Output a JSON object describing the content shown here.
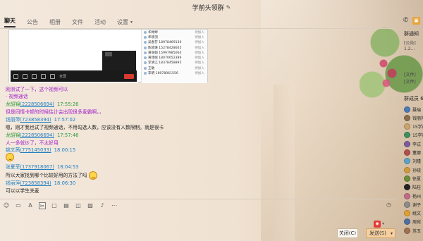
{
  "window": {
    "title": "学前头领群"
  },
  "tabs": [
    {
      "label": "聊天",
      "active": true
    },
    {
      "label": "公告"
    },
    {
      "label": "相册"
    },
    {
      "label": "文件"
    },
    {
      "label": "活动"
    },
    {
      "label": "设置"
    }
  ],
  "screenshot": {
    "members": [
      {
        "name": "华婷婷",
        "status": "待加入"
      },
      {
        "name": "年晓羽",
        "status": "待加入"
      },
      {
        "name": "吴春芬 18978469130",
        "status": "待加入"
      },
      {
        "name": "陈晓琳  15278428605",
        "status": "待加入"
      },
      {
        "name": "黄丽娟 15997985064",
        "status": "待加入"
      },
      {
        "name": "黄佳妮 18070652389",
        "status": "待加入"
      },
      {
        "name": "李清江 18378458895",
        "status": "待加入"
      },
      {
        "name": "王敏",
        "status": "待加入"
      },
      {
        "name": "李明 18078061556",
        "status": "待加入"
      }
    ],
    "toolbar_label": "全屏"
  },
  "messages": [
    {
      "type": "text",
      "style": "purple",
      "text": "刚测试了一下，这个视频可以"
    },
    {
      "type": "text",
      "style": "purple",
      "text": "· 视频通话"
    },
    {
      "type": "header",
      "sender": "龙韶锦",
      "qq": "(2228506694)",
      "time": "17:55:26",
      "color": "green"
    },
    {
      "type": "text",
      "style": "purple",
      "text": "但是同情卡顿的时候估计会出现很多麦霸啊，，"
    },
    {
      "type": "header",
      "sender": "钱丽萍",
      "qq": "(723858394)",
      "time": "17:57:02",
      "color": "blue"
    },
    {
      "type": "text",
      "style": "plain",
      "text": "嗯，刚才我也试了视频通话，不用勾选人数，应该没有人数限制。就是很卡"
    },
    {
      "type": "header",
      "sender": "龙韶锦",
      "qq": "(2228506694)",
      "time": "17:57:46",
      "color": "green"
    },
    {
      "type": "text",
      "style": "purple",
      "text": "人一多就炒了，不太好用"
    },
    {
      "type": "header",
      "sender": "姚文茜",
      "qq": "(775145033)",
      "time": "18:00:15",
      "color": "blue"
    },
    {
      "type": "emoji"
    },
    {
      "type": "header",
      "sender": "张夏菲",
      "qq": "(1737918067)",
      "time": "18:04:53",
      "color": "blue"
    },
    {
      "type": "text",
      "style": "plain",
      "text": "所以大家找到哪个比较好用的方法了吗"
    },
    {
      "type": "header",
      "sender": "钱丽萍",
      "qq": "(723858394)",
      "time": "18:06:30",
      "color": "blue"
    },
    {
      "type": "text",
      "style": "plain",
      "text": "可以以学生关麦"
    }
  ],
  "input_toolbar": [
    "smile-icon",
    "gif-icon",
    "scissors-icon",
    "folder-icon",
    "image-icon",
    "gift-icon",
    "picture-icon",
    "mic-icon",
    "more-icon"
  ],
  "buttons": {
    "close": "关闭(C)",
    "send": "发送(S)"
  },
  "group_panel": {
    "title": "群通知",
    "announce_lines": [
      "[公告]",
      "1.2...",
      "[文件]",
      "[文件]"
    ],
    "members_title": "群成员 6",
    "members": [
      {
        "name": "聂瑞",
        "color": "#4a7bb7"
      },
      {
        "name": "钱丽萍",
        "color": "#8a6d4b"
      },
      {
        "name": "15学前",
        "color": "#c9a56a"
      },
      {
        "name": "15学前",
        "color": "#3f8f5f"
      },
      {
        "name": "李忒",
        "color": "#7d5a9e"
      },
      {
        "name": "董娜",
        "color": "#b44d4d"
      },
      {
        "name": "刘瑾",
        "color": "#5aa3c8"
      },
      {
        "name": "孙晓",
        "color": "#d19b3c"
      },
      {
        "name": "徐夏",
        "color": "#6c8e3a"
      },
      {
        "name": "陆桂",
        "color": "#222222"
      },
      {
        "name": "杨州",
        "color": "#c36a8a"
      },
      {
        "name": "谢子",
        "color": "#8c8c8c"
      },
      {
        "name": "姚文",
        "color": "#e0a030"
      },
      {
        "name": "周宛",
        "color": "#4d6fa1"
      },
      {
        "name": "苏玉",
        "color": "#a07050"
      }
    ]
  }
}
